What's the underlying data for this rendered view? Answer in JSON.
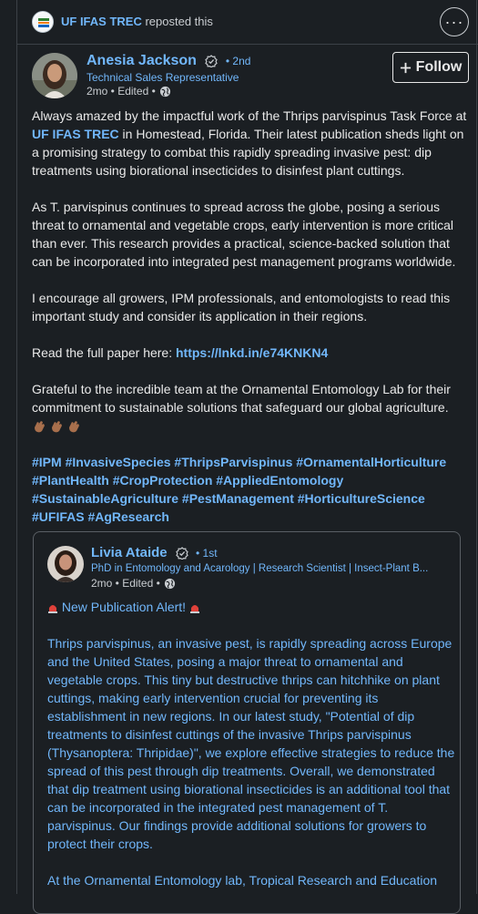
{
  "repost": {
    "org": "UF IFAS TREC",
    "action": "reposted this"
  },
  "author": {
    "name": "Anesia Jackson",
    "degree": "• 2nd",
    "headline": "Technical Sales Representative",
    "time": "2mo • Edited •",
    "follow_label": "Follow"
  },
  "post": {
    "p1_a": "Always amazed by the impactful work of the Thrips parvispinus Task Force at ",
    "p1_org": "UF IFAS TREC",
    "p1_b": " in Homestead, Florida. Their latest publication sheds light on a promising strategy to combat this rapidly spreading invasive pest: dip treatments using biorational insecticides to disinfest plant cuttings.",
    "p2": "As T. parvispinus continues to spread across the globe, posing a serious threat to ornamental and vegetable crops, early intervention is more critical than ever. This research provides a practical, science-backed solution that can be incorporated into integrated pest management programs worldwide.",
    "p3": "I encourage all growers, IPM professionals, and entomologists to read this important study and consider its application in their regions.",
    "p4_a": "Read the full paper here: ",
    "p4_link": "https://lnkd.in/e74KNKN4",
    "p5": "Grateful to the incredible team at the Ornamental Entomology Lab for their commitment to sustainable solutions that safeguard our global agriculture.",
    "hashtags": "#IPM #InvasiveSpecies #ThripsParvispinus #OrnamentalHorticulture #PlantHealth #CropProtection #AppliedEntomology #SustainableAgriculture #PestManagement #HorticultureScience #UFIFAS #AgResearch"
  },
  "quoted": {
    "name": "Livia Ataide",
    "degree": "• 1st",
    "headline": "PhD in Entomology and Acarology | Research Scientist | Insect-Plant B...",
    "time": "2mo • Edited •",
    "alert": " New Publication Alert! ",
    "p1": "Thrips parvispinus, an invasive pest, is rapidly spreading across Europe and the United States, posing a major threat to ornamental and vegetable crops. This tiny but destructive thrips can hitchhike on plant cuttings, making early intervention crucial for preventing its establishment in new regions. In our latest study, \"Potential of dip treatments to disinfest cuttings of the invasive Thrips parvispinus (Thysanoptera: Thripidae)\", we explore effective strategies to reduce the spread of this pest through dip treatments. Overall, we demonstrated that dip treatment using biorational insecticides is an additional tool that can be incorporated in the integrated pest management of T. parvispinus. Our findings provide additional solutions for growers to protect their crops.",
    "p2": "At the Ornamental Entomology lab, Tropical Research and Education"
  },
  "colors": {
    "background": "#1b1f23",
    "link": "#71b7fb",
    "text": "#e9e9e9",
    "alert": "#e0413a"
  },
  "icons": [
    "org-logo-icon",
    "more-icon",
    "verified-icon",
    "globe-icon",
    "plus-icon",
    "alert-siren-icon",
    "clap-icon"
  ]
}
